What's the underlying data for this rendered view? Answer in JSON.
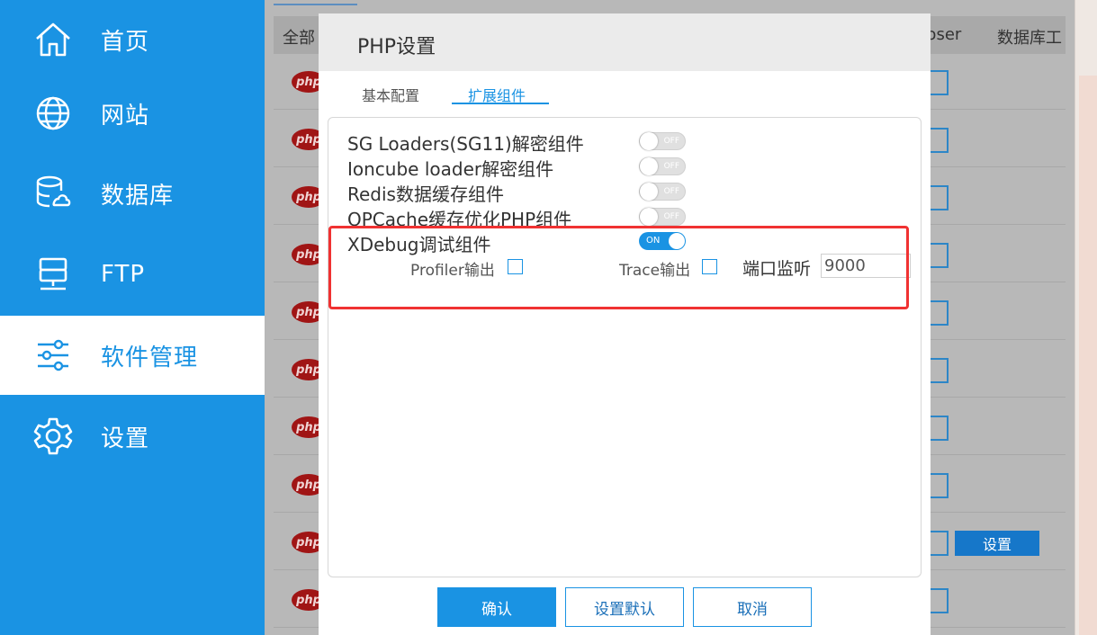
{
  "sidebar": {
    "items": [
      {
        "label": "首页",
        "icon": "home-icon"
      },
      {
        "label": "网站",
        "icon": "globe-icon"
      },
      {
        "label": "数据库",
        "icon": "database-icon"
      },
      {
        "label": "FTP",
        "icon": "server-icon"
      },
      {
        "label": "软件管理",
        "icon": "sliders-icon",
        "active": true
      },
      {
        "label": "设置",
        "icon": "gear-icon"
      }
    ]
  },
  "background_table": {
    "header_all": "全部",
    "header_composer": "poser",
    "header_dbtool": "数据库工",
    "row_button": "设置"
  },
  "dialog": {
    "title": "PHP设置",
    "tabs": [
      {
        "label": "基本配置"
      },
      {
        "label": "扩展组件",
        "active": true
      }
    ],
    "extensions": [
      {
        "label": "SG Loaders(SG11)解密组件",
        "toggle": "OFF"
      },
      {
        "label": "Ioncube loader解密组件",
        "toggle": "OFF"
      },
      {
        "label": "Redis数据缓存组件",
        "toggle": "OFF"
      },
      {
        "label": "OPCache缓存优化PHP组件",
        "toggle": "OFF"
      },
      {
        "label": "XDebug调试组件",
        "toggle": "ON"
      }
    ],
    "xdebug": {
      "profiler_label": "Profiler输出",
      "trace_label": "Trace输出",
      "port_label": "端口监听",
      "port_value": "9000"
    },
    "buttons": {
      "confirm": "确认",
      "set_default": "设置默认",
      "cancel": "取消"
    }
  },
  "colors": {
    "sidebar_blue": "#1a93e3",
    "highlight_red": "#f03232"
  }
}
